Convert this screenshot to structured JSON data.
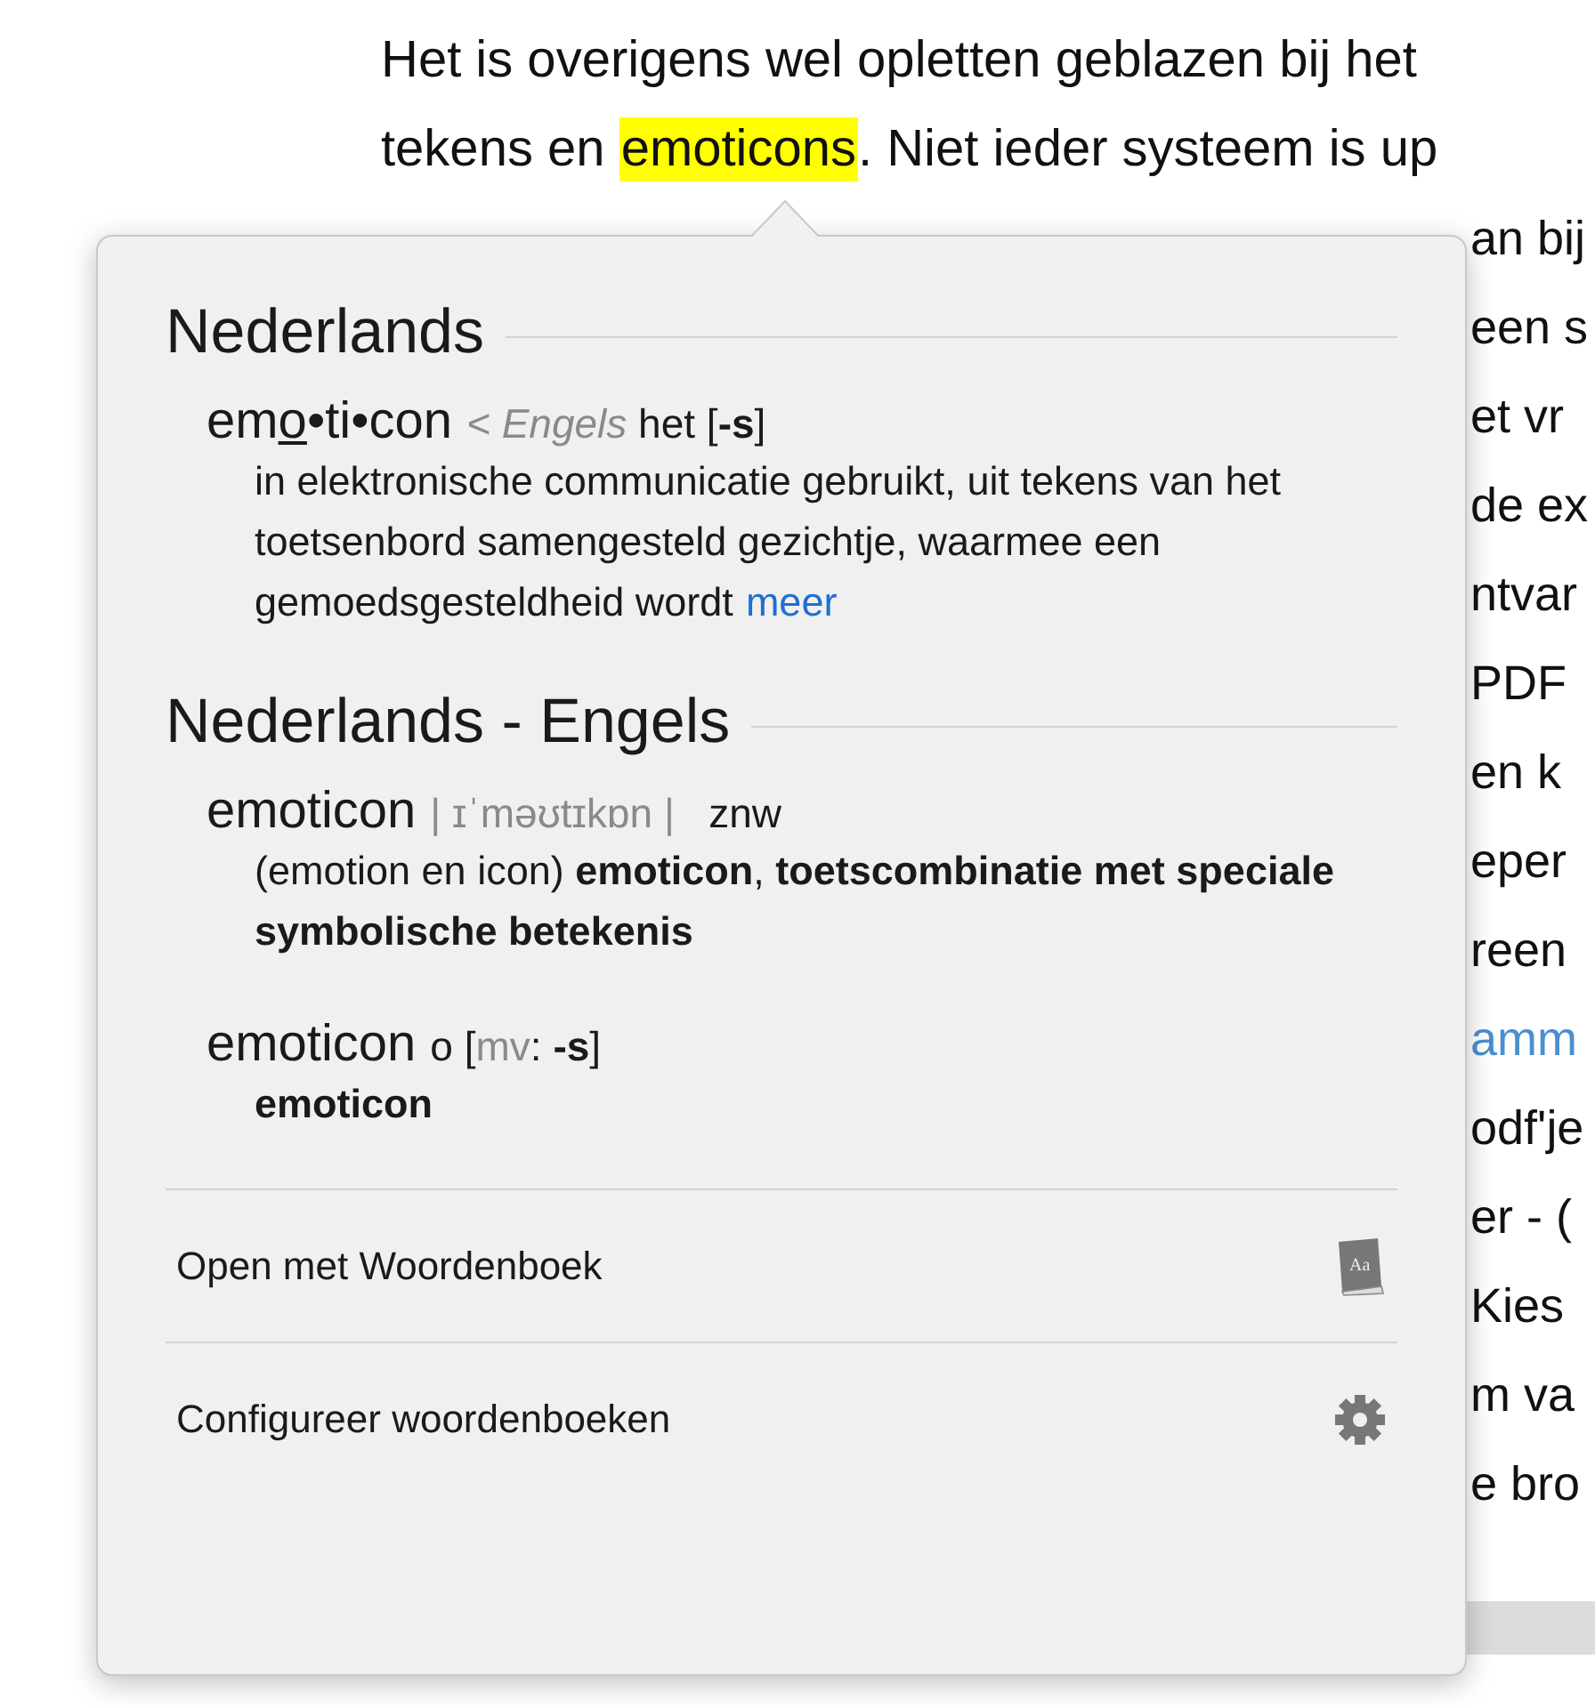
{
  "article": {
    "lines": [
      {
        "parts": [
          {
            "text": "Het is overigens wel opletten geblazen bij het",
            "highlighted": false
          }
        ]
      },
      {
        "parts": [
          {
            "text": "tekens en ",
            "highlighted": false
          },
          {
            "text": "emoticons",
            "highlighted": true
          },
          {
            "text": ". Niet ieder systeem is up",
            "highlighted": false
          }
        ]
      }
    ],
    "fragments": [
      {
        "text": "an bij",
        "link": false
      },
      {
        "text": "een s",
        "link": false
      },
      {
        "text": "et vr",
        "link": false
      },
      {
        "text": "de ex",
        "link": false
      },
      {
        "text": "ntvar",
        "link": false
      },
      {
        "text": "PDF",
        "link": false
      },
      {
        "text": "en k",
        "link": false
      },
      {
        "text": "eper",
        "link": false
      },
      {
        "text": "reen",
        "link": false
      },
      {
        "text": "amm",
        "link": true
      },
      {
        "text": "odf'je",
        "link": false
      },
      {
        "text": "er - (",
        "link": false
      },
      {
        "text": "Kies",
        "link": false
      },
      {
        "text": "m va",
        "link": false
      },
      {
        "text": "e bro",
        "link": false
      }
    ]
  },
  "popover": {
    "sections": [
      {
        "title": "Nederlands",
        "entries": [
          {
            "headword": [
              {
                "text": "em",
                "underlined": false
              },
              {
                "text": "o",
                "underlined": true
              },
              {
                "text": "•ti•con",
                "underlined": false
              }
            ],
            "meta": [
              {
                "text": "< Engels",
                "kind": "origin"
              },
              {
                "text": " het [",
                "kind": "plain"
              },
              {
                "text": "-s",
                "kind": "strong"
              },
              {
                "text": "]",
                "kind": "plain"
              }
            ],
            "definition": "in elektronische communicatie gebruikt, uit tekens van het toetsenbord samengesteld gezichtje, waarmee een gemoedsgesteldheid wordt",
            "definition_bold": false,
            "more": "meer"
          }
        ]
      },
      {
        "title": "Nederlands - Engels",
        "entries": [
          {
            "headword": [
              {
                "text": "emoticon",
                "underlined": false
              }
            ],
            "meta": [
              {
                "text": "| ɪˈməʊtɪkɒn |",
                "kind": "label"
              },
              {
                "text": "   znw",
                "kind": "plain"
              }
            ],
            "definition": "(emotion en icon) **emoticon**, **toetscombinatie met speciale symbolische betekenis**",
            "definition_bold": false
          },
          {
            "headword": [
              {
                "text": "emoticon",
                "underlined": false
              }
            ],
            "meta": [
              {
                "text": "o [",
                "kind": "plain"
              },
              {
                "text": "mv",
                "kind": "label"
              },
              {
                "text": ": ",
                "kind": "plain"
              },
              {
                "text": "-s",
                "kind": "strong"
              },
              {
                "text": "]",
                "kind": "plain"
              }
            ],
            "definition": "emoticon",
            "definition_bold": true
          }
        ]
      }
    ],
    "actions": [
      {
        "label": "Open met Woordenboek",
        "kind": "book",
        "icon_text": "Aa"
      },
      {
        "label": "Configureer woordenboeken",
        "kind": "gear"
      }
    ]
  }
}
